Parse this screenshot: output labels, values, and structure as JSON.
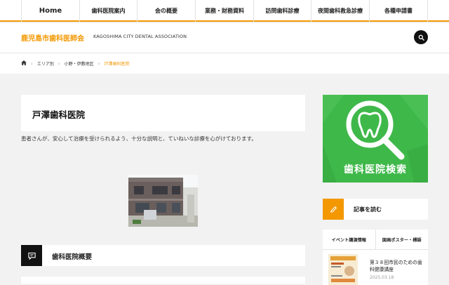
{
  "nav": {
    "items": [
      {
        "label": "Home"
      },
      {
        "label": "歯科医院案内"
      },
      {
        "label": "会の概要"
      },
      {
        "label": "業務・財務資料"
      },
      {
        "label": "訪問歯科診療"
      },
      {
        "label": "夜間歯科救急診療"
      },
      {
        "label": "各種申請書"
      }
    ]
  },
  "header": {
    "site_title": "鹿児島市歯科医師会",
    "site_subtitle": "KAGOSHIMA CITY DENTAL ASSOCIATION"
  },
  "breadcrumb": {
    "items": [
      "エリア別",
      "小野・伊敷地区"
    ],
    "current": "戸澤歯科医院"
  },
  "main": {
    "title": "戸澤歯科医院",
    "intro": "患者さんが、安心して治療を受けられるよう、十分な説明と、ていねいな診療を心がけております。",
    "section_title": "歯科医院概要"
  },
  "sidebar": {
    "banner_label": "歯科医院検索",
    "read_title": "記事を読む",
    "tabs": [
      "イベント講演情報",
      "図画ポスター・標語"
    ],
    "news": {
      "title": "第３８回市民のための歯科健康講座",
      "date": "2025.03.18"
    }
  },
  "colors": {
    "accent": "#f39800",
    "banner": "#3fb84a",
    "dark": "#111111",
    "background": "#f2f2f2"
  }
}
